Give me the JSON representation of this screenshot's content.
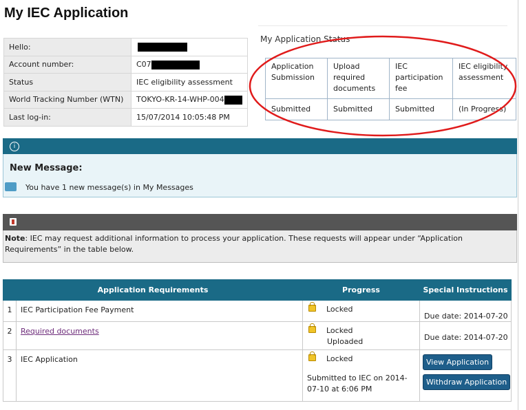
{
  "page": {
    "title": "My IEC Application"
  },
  "account": {
    "rows": [
      {
        "label": "Hello:",
        "value": ""
      },
      {
        "label": "Account number:",
        "value": "C07"
      },
      {
        "label": "Status",
        "value": "IEC eligibility assessment"
      },
      {
        "label": "World Tracking Number (WTN)",
        "value": "TOKYO-KR-14-WHP-004"
      },
      {
        "label": "Last log-in:",
        "value": "15/07/2014 10:05:48 PM"
      }
    ]
  },
  "status": {
    "title": "My Application Status",
    "columns": [
      "Application Submission",
      "Upload required documents",
      "IEC participation fee",
      "IEC eligibility assessment"
    ],
    "values": [
      "Submitted",
      "Submitted",
      "Submitted",
      "(In Progress)"
    ],
    "annotation_color": "#e01b1b"
  },
  "message": {
    "title": "New Message:",
    "text": "You have 1 new message(s) in My Messages"
  },
  "note": {
    "label": "Note",
    "text": ": IEC may request additional information to process your application. These requests will appear under “Application Requirements” in the table below."
  },
  "requirements": {
    "headers": [
      "Application Requirements",
      "Progress",
      "Special Instructions"
    ],
    "rows": [
      {
        "num": "1",
        "name": "IEC Participation Fee Payment",
        "progress": "Locked",
        "instruction": "Due date: 2014-07-20"
      },
      {
        "num": "2",
        "name": "Required documents",
        "progress": "Locked",
        "progress_extra": "Uploaded",
        "instruction": "Due date: 2014-07-20"
      },
      {
        "num": "3",
        "name": "IEC Application",
        "progress": "Locked",
        "progress_extra": "Submitted to IEC on 2014-07-10 at 6:06 PM",
        "button_view": "View Application",
        "button_withdraw": "Withdraw Application"
      }
    ]
  },
  "colors": {
    "panel_header": "#1a6a86",
    "note_header": "#555555",
    "button": "#1e5e8a"
  }
}
